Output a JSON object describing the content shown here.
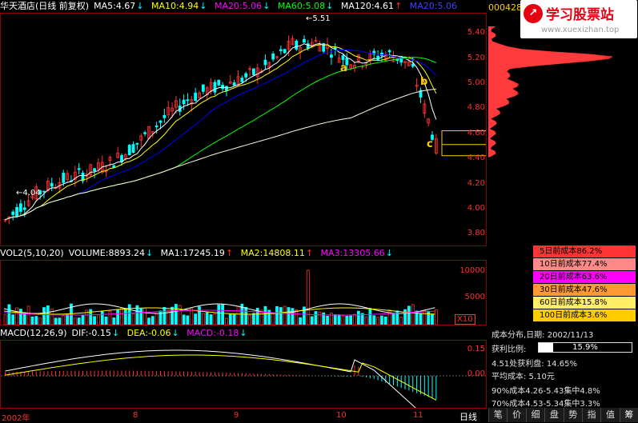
{
  "header": {
    "name": "华天酒店(日线 前复权)",
    "ma5": "MA5:4.67",
    "ma10": "MA10:4.94",
    "ma20": "MA20:5.06",
    "ma60": "MA60:5.08",
    "ma120": "MA120:4.61",
    "ma200": "MA20:5.06"
  },
  "logo": {
    "code": "000428",
    "title": "学习股票站",
    "url": "www.xuexizhan.top"
  },
  "price_axis": [
    "5.40",
    "5.20",
    "5.00",
    "4.80",
    "4.60",
    "4.40",
    "4.20",
    "4.00",
    "3.80"
  ],
  "annotations": {
    "high": "5.51",
    "low": "4.04",
    "a": "a",
    "b": "b",
    "c": "c"
  },
  "vol_header": {
    "name": "VOL2(5,10,20)",
    "volume": "VOLUME:8893.24",
    "ma1": "MA1:17245.19",
    "ma2": "MA2:14808.11",
    "ma3": "MA3:13305.66"
  },
  "vol_axis": [
    "10000",
    "5000"
  ],
  "vol_unit": "X10",
  "macd_header": {
    "name": "MACD(12,26,9)",
    "dif": "DIF:-0.15",
    "dea": "DEA:-0.06",
    "macd": "MACD:-0.18"
  },
  "macd_axis": [
    "0.15",
    "0.00"
  ],
  "dates": [
    "2002年",
    "8",
    "9",
    "10",
    "11"
  ],
  "period_label": "日线",
  "cost_legend": [
    {
      "label": "5日前成本86.2%",
      "color": "#ff3333"
    },
    {
      "label": "10日前成本77.4%",
      "color": "#ff8888"
    },
    {
      "label": "20日前成本63.6%",
      "color": "#ff00ff"
    },
    {
      "label": "30日前成本47.6%",
      "color": "#ff9933"
    },
    {
      "label": "60日前成本15.8%",
      "color": "#ffee66"
    },
    {
      "label": "100日前成本3.6%",
      "color": "#ffcc00"
    }
  ],
  "cost_info": {
    "title": "成本分布,日期: 2002/11/13",
    "profit_label": "获利比例:",
    "profit_value": "15.9%",
    "profit_ratio": 0.159,
    "profit_line": "4.51处获利盘: 14.65%",
    "avg_cost": "平均成本: 5.10元",
    "c90": "90%成本4.26-5.43集中4.8%",
    "c70": "70%成本4.53-5.34集中3.3%"
  },
  "tabs": [
    "笔",
    "价",
    "细",
    "盘",
    "势",
    "指",
    "值",
    "筹"
  ],
  "colors": {
    "up": "#ff3030",
    "down": "#00ffff",
    "ma5": "#ffffff",
    "ma10": "#ffff00",
    "ma20": "#ff00ff",
    "ma60": "#00ff00",
    "ma120": "#ffffff",
    "border": "#8b0000"
  }
}
